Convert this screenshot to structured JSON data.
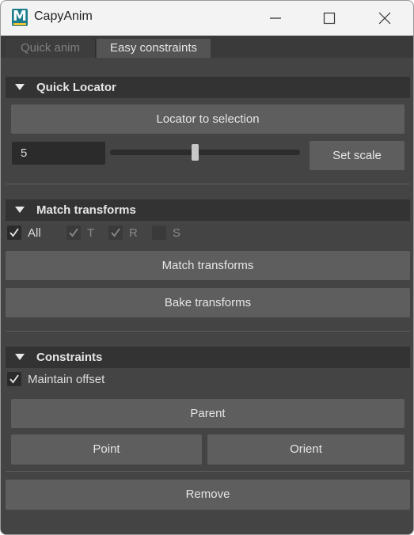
{
  "window": {
    "title": "CapyAnim",
    "icon_letter": "M"
  },
  "tabs": [
    {
      "label": "Quick anim",
      "active": false
    },
    {
      "label": "Easy constraints",
      "active": true
    }
  ],
  "quick_locator": {
    "header": "Quick Locator",
    "locator_button": "Locator to selection",
    "scale_value": "5",
    "set_scale_button": "Set scale"
  },
  "match_transforms": {
    "header": "Match transforms",
    "checks": {
      "all": {
        "label": "All",
        "checked": true
      },
      "t": {
        "label": "T",
        "checked": true
      },
      "r": {
        "label": "R",
        "checked": true
      },
      "s": {
        "label": "S",
        "checked": false
      }
    },
    "match_button": "Match transforms",
    "bake_button": "Bake transforms"
  },
  "constraints": {
    "header": "Constraints",
    "maintain_offset": {
      "label": "Maintain offset",
      "checked": true
    },
    "parent_button": "Parent",
    "point_button": "Point",
    "orient_button": "Orient",
    "remove_button": "Remove"
  },
  "colors": {
    "background": "#444444",
    "header": "#333333",
    "button": "#5e5e5e",
    "field": "#2b2b2b",
    "text": "#e6e6e6"
  }
}
